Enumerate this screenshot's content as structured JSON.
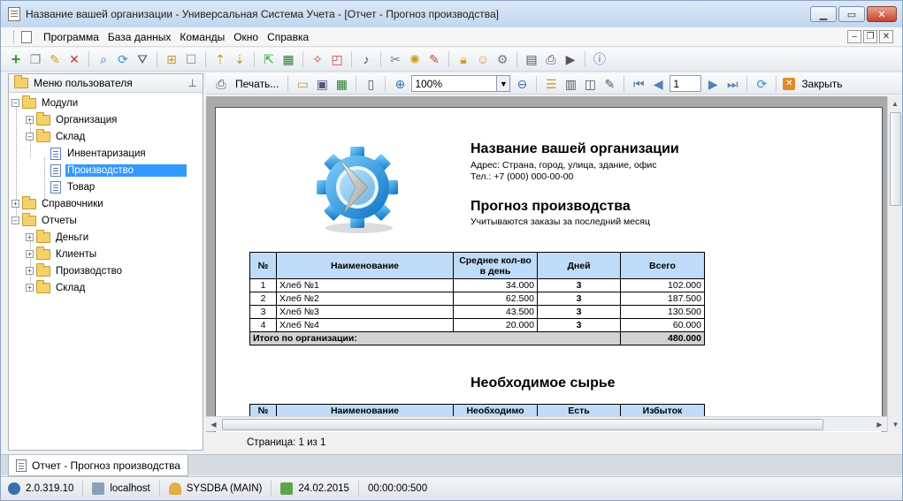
{
  "window": {
    "title": "Название вашей организации - Универсальная Система Учета - [Отчет - Прогноз производства]"
  },
  "menu": [
    "Программа",
    "База данных",
    "Команды",
    "Окно",
    "Справка"
  ],
  "left_panel": {
    "title": "Меню пользователя",
    "tree": [
      {
        "label": "Модули",
        "level": 0,
        "type": "folder",
        "expanded": true
      },
      {
        "label": "Организация",
        "level": 1,
        "type": "folder",
        "expanded": false
      },
      {
        "label": "Склад",
        "level": 1,
        "type": "folder",
        "expanded": true
      },
      {
        "label": "Инвентаризация",
        "level": 2,
        "type": "doc"
      },
      {
        "label": "Производство",
        "level": 2,
        "type": "doc",
        "selected": true
      },
      {
        "label": "Товар",
        "level": 2,
        "type": "doc"
      },
      {
        "label": "Справочники",
        "level": 0,
        "type": "folder",
        "expanded": false
      },
      {
        "label": "Отчеты",
        "level": 0,
        "type": "folder",
        "expanded": true
      },
      {
        "label": "Деньги",
        "level": 1,
        "type": "folder",
        "expanded": false
      },
      {
        "label": "Клиенты",
        "level": 1,
        "type": "folder",
        "expanded": false
      },
      {
        "label": "Производство",
        "level": 1,
        "type": "folder",
        "expanded": false
      },
      {
        "label": "Склад",
        "level": 1,
        "type": "folder",
        "expanded": false
      }
    ]
  },
  "report_toolbar": {
    "print_label": "Печать...",
    "zoom": "100%",
    "page": "1",
    "close_label": "Закрыть"
  },
  "report": {
    "org_name": "Название вашей организации",
    "address": "Адрес: Страна, город, улица, здание, офис",
    "phone": "Тел.: +7 (000) 000-00-00",
    "title": "Прогноз производства",
    "subtitle": "Учитываются заказы за последний месяц",
    "table1": {
      "headers": [
        "№",
        "Наименование",
        "Среднее кол-во в день",
        "Дней",
        "Всего"
      ],
      "rows": [
        [
          "1",
          "Хлеб №1",
          "34.000",
          "3",
          "102.000"
        ],
        [
          "2",
          "Хлеб №2",
          "62.500",
          "3",
          "187.500"
        ],
        [
          "3",
          "Хлеб №3",
          "43.500",
          "3",
          "130.500"
        ],
        [
          "4",
          "Хлеб №4",
          "20.000",
          "3",
          "60.000"
        ]
      ],
      "total_label": "Итого по организации:",
      "total_value": "480.000"
    },
    "section2_title": "Необходимое сырье",
    "table2": {
      "headers": [
        "№",
        "Наименование",
        "Необходимо",
        "Есть",
        "Избыток"
      ]
    }
  },
  "page_status": "Страница: 1 из 1",
  "tab": "Отчет - Прогноз производства",
  "status": {
    "version": "2.0.319.10",
    "host": "localhost",
    "user": "SYSDBA (MAIN)",
    "date": "24.02.2015",
    "time": "00:00:00:500"
  }
}
